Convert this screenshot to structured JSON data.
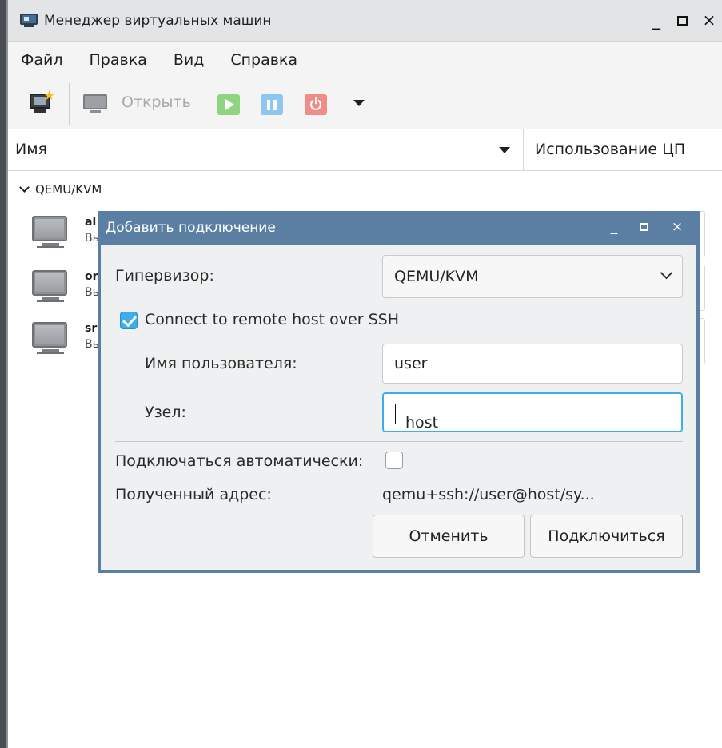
{
  "window": {
    "title": "Менеджер виртуальных машин",
    "minimize_glyph": "_",
    "close_glyph": "×"
  },
  "menubar": {
    "items": [
      "Файл",
      "Правка",
      "Вид",
      "Справка"
    ]
  },
  "toolbar": {
    "new_icon": "new-vm-icon",
    "open_label": "Открыть",
    "run_icon": "play-icon",
    "pause_icon": "pause-icon",
    "stop_icon": "power-icon",
    "more_icon": "dropdown-arrow-icon"
  },
  "columns": {
    "name": "Имя",
    "cpu": "Использование ЦП"
  },
  "tree": {
    "group": "QEMU/KVM",
    "vms": [
      {
        "name": "al",
        "state": "Вы"
      },
      {
        "name": "or",
        "state": "Вы"
      },
      {
        "name": "sr",
        "state": "Вы"
      }
    ]
  },
  "dialog": {
    "title": "Добавить подключение",
    "minimize_glyph": "_",
    "close_glyph": "×",
    "hypervisor_label": "Гипервизор:",
    "hypervisor_value": "QEMU/KVM",
    "ssh_label": "Connect to remote host over SSH",
    "ssh_checked": true,
    "username_label": "Имя пользователя:",
    "username_value": "user",
    "host_label": "Узел:",
    "host_value": "host",
    "autoconnect_label": "Подключаться автоматически:",
    "autoconnect_checked": false,
    "uri_label": "Полученный адрес:",
    "uri_value": "qemu+ssh://user@host/sy...",
    "cancel_label": "Отменить",
    "connect_label": "Подключиться"
  },
  "colors": {
    "dialog_frame": "#5b7fa3",
    "accent": "#3daee9",
    "run": "#8fd47f",
    "pause": "#8ec6ef",
    "stop": "#ef8d86"
  }
}
